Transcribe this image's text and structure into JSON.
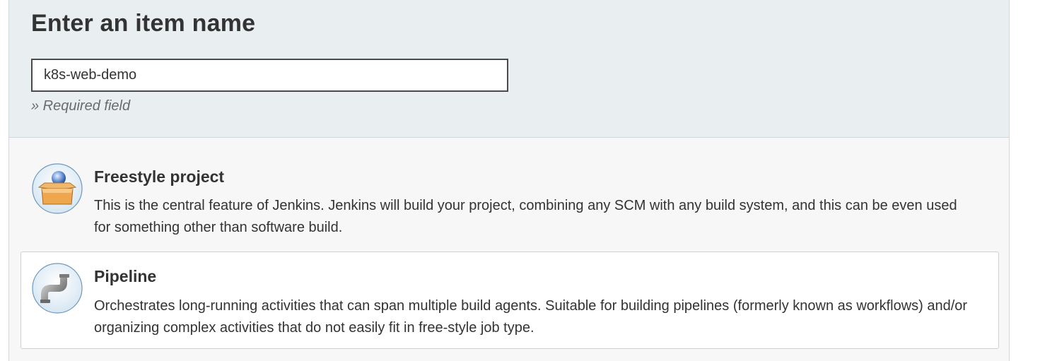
{
  "header": {
    "title": "Enter an item name",
    "name_input_value": "k8s-web-demo",
    "required_note": "» Required field"
  },
  "item_types": [
    {
      "title": "Freestyle project",
      "description": "This is the central feature of Jenkins. Jenkins will build your project, combining any SCM with any build system, and this can be even used for something other than software build.",
      "icon": "freestyle-project-box-icon",
      "selected": false
    },
    {
      "title": "Pipeline",
      "description": "Orchestrates long-running activities that can span multiple build agents. Suitable for building pipelines (formerly known as workflows) and/or organizing complex activities that do not easily fit in free-style job type.",
      "icon": "pipeline-pipe-icon",
      "selected": true
    }
  ]
}
